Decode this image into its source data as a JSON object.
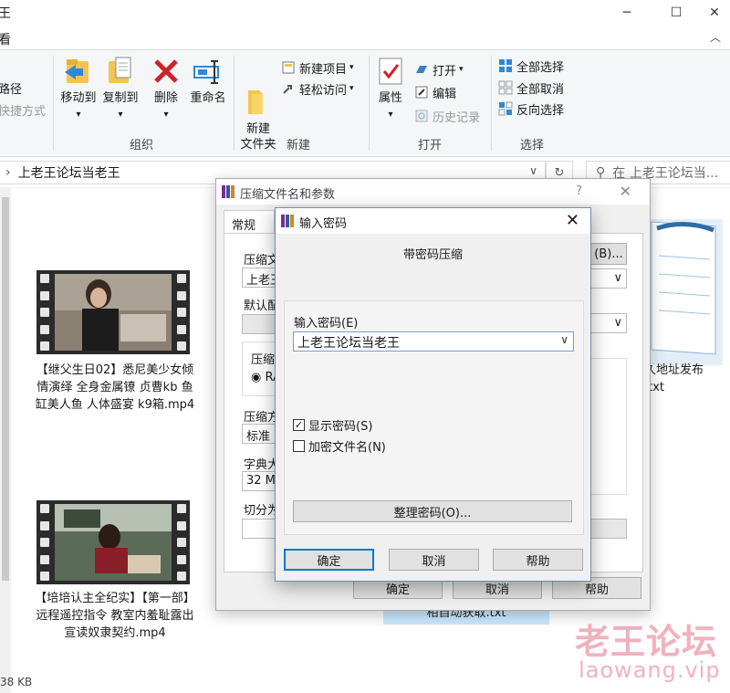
{
  "explorer": {
    "title": "王",
    "menu_view": "看",
    "ribbon": {
      "path_label": "路径",
      "shortcut_label": "快捷方式",
      "move_to": "移动到",
      "copy_to": "复制到",
      "delete": "删除",
      "rename": "重命名",
      "organize": "组织",
      "new_folder": "新建\n文件夹",
      "new_item": "新建项目",
      "easy_access": "轻松访问",
      "new_group": "新建",
      "properties": "属性",
      "open": "打开",
      "edit": "编辑",
      "history": "历史记录",
      "open_group": "打开",
      "select_all": "全部选择",
      "select_none": "全部取消",
      "invert_selection": "反向选择",
      "select_group": "选择"
    },
    "address": "上老王论坛当老王",
    "search_placeholder": "在 上老王论坛当...",
    "files": [
      {
        "name": "【继父生日02】悉尼美少女倾情演绎 全身金属镣 贞曹kb 鱼缸美人鱼 人体盛宴 k9箱.mp4"
      },
      {
        "name": "【培培认主全纪实】【第一部】远程遥控指令 教室内羞耻露出 宣读奴隶契约.mp4"
      },
      {
        "name": "久地址发布\n.txt"
      },
      {
        "name": "相自动获取.txt"
      }
    ],
    "status": "38 KB"
  },
  "archive_dialog": {
    "title": "压缩文件名和参数",
    "help_icon": "?",
    "tab_general": "常规",
    "archive_name_label": "压缩文",
    "archive_name_value": "上老王",
    "browse_btn": "(B)...",
    "default_profile_label": "默认配",
    "format_label": "压缩",
    "format_radio": "RA",
    "method_label": "压缩方",
    "method_value": "标准",
    "dict_label": "字典大",
    "dict_value": "32 MB",
    "split_label": "切分为",
    "ok": "确定",
    "cancel": "取消",
    "help": "帮助"
  },
  "password_dialog": {
    "title": "输入密码",
    "subtitle": "带密码压缩",
    "enter_label": "输入密码(E)",
    "password_value": "上老王论坛当老王",
    "show_password": "显示密码(S)",
    "show_password_checked": true,
    "encrypt_names": "加密文件名(N)",
    "encrypt_names_checked": false,
    "organize_btn": "整理密码(O)...",
    "ok": "确定",
    "cancel": "取消",
    "help": "帮助"
  },
  "watermark": {
    "cn": "老王论坛",
    "url": "laowang.vip"
  }
}
